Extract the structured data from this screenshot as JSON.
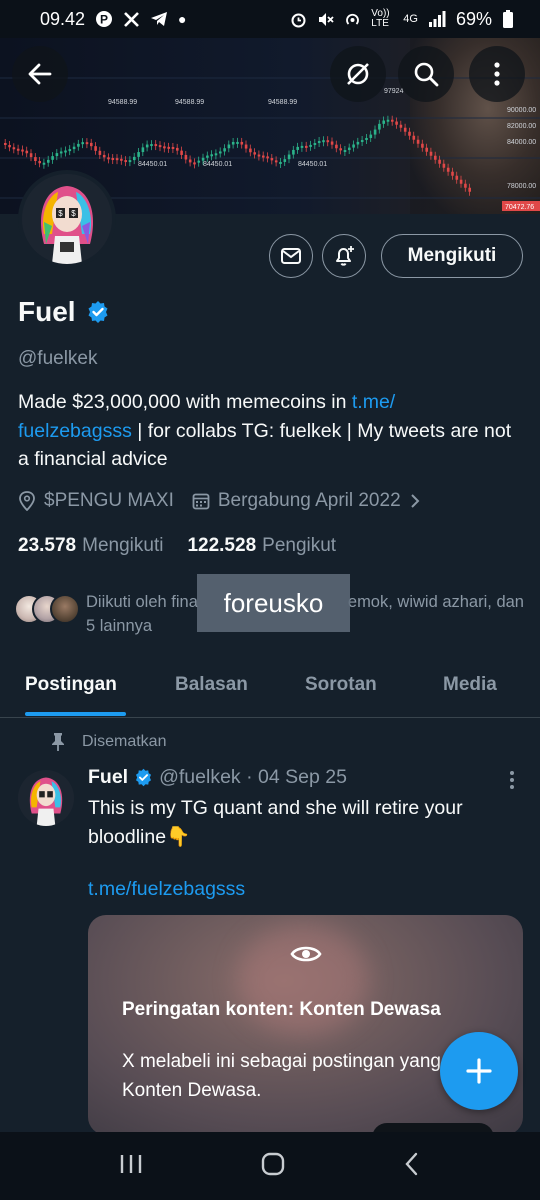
{
  "status_bar": {
    "time": "09.42",
    "left_icons": [
      "pinterest-icon",
      "x-icon",
      "telegram-icon",
      "dot-icon"
    ],
    "right_icons": [
      "alarm-icon",
      "mute-icon",
      "hotspot-icon",
      "volte-icon",
      "4g-icon",
      "signal-icon"
    ],
    "volte": "Vo)) LTE",
    "network": "4G",
    "battery": "69%"
  },
  "banner": {
    "price_labels": [
      "94588.99",
      "94588.99",
      "94588.99",
      "97924",
      "84450.01",
      "84450.01",
      "84450.01"
    ],
    "axis_labels": [
      "90000.00",
      "82000.00",
      "84000.00",
      "78000.00",
      "70472.76"
    ]
  },
  "profile": {
    "name": "Fuel",
    "verified": true,
    "handle": "@fuelkek",
    "bio": {
      "text_before": "Made $23,000,000 with memecoins in ",
      "link_line1": "t.me/",
      "link_line2": "fuelzebagsss",
      "text_after": " | for collabs TG: fuelkek | My tweets are not a financial advice"
    },
    "location": "$PENGU MAXI",
    "joined": "Bergabung April 2022",
    "following_count": "23.578",
    "following_label": "Mengikuti",
    "followers_count": "122.528",
    "followers_label": "Pengikut",
    "followed_by_prefix": "Diikuti oleh fina",
    "followed_by_suffix": "emok, wiwid azhari, dan 5 lainnya",
    "follow_button": "Mengikuti"
  },
  "watermark": "foreusko",
  "tabs": [
    {
      "label": "Postingan",
      "active": true
    },
    {
      "label": "Balasan",
      "active": false
    },
    {
      "label": "Sorotan",
      "active": false
    },
    {
      "label": "Media",
      "active": false
    }
  ],
  "pinned_tweet": {
    "pinned_label": "Disematkan",
    "author": "Fuel",
    "handle_date": "@fuelkek · 04 Sep 25",
    "text": "This is my TG quant and she will retire your bloodline👇",
    "link": "t.me/fuelzebagsss",
    "media": {
      "warning_title": "Peringatan konten: Konten Dewasa",
      "warning_desc": "X melabeli ini sebagai postingan yang berisi Konten Dewasa."
    }
  },
  "colors": {
    "background": "#15202b",
    "accent": "#1d9bf0",
    "secondary_text": "#8b98a5",
    "border": "#38444d"
  }
}
